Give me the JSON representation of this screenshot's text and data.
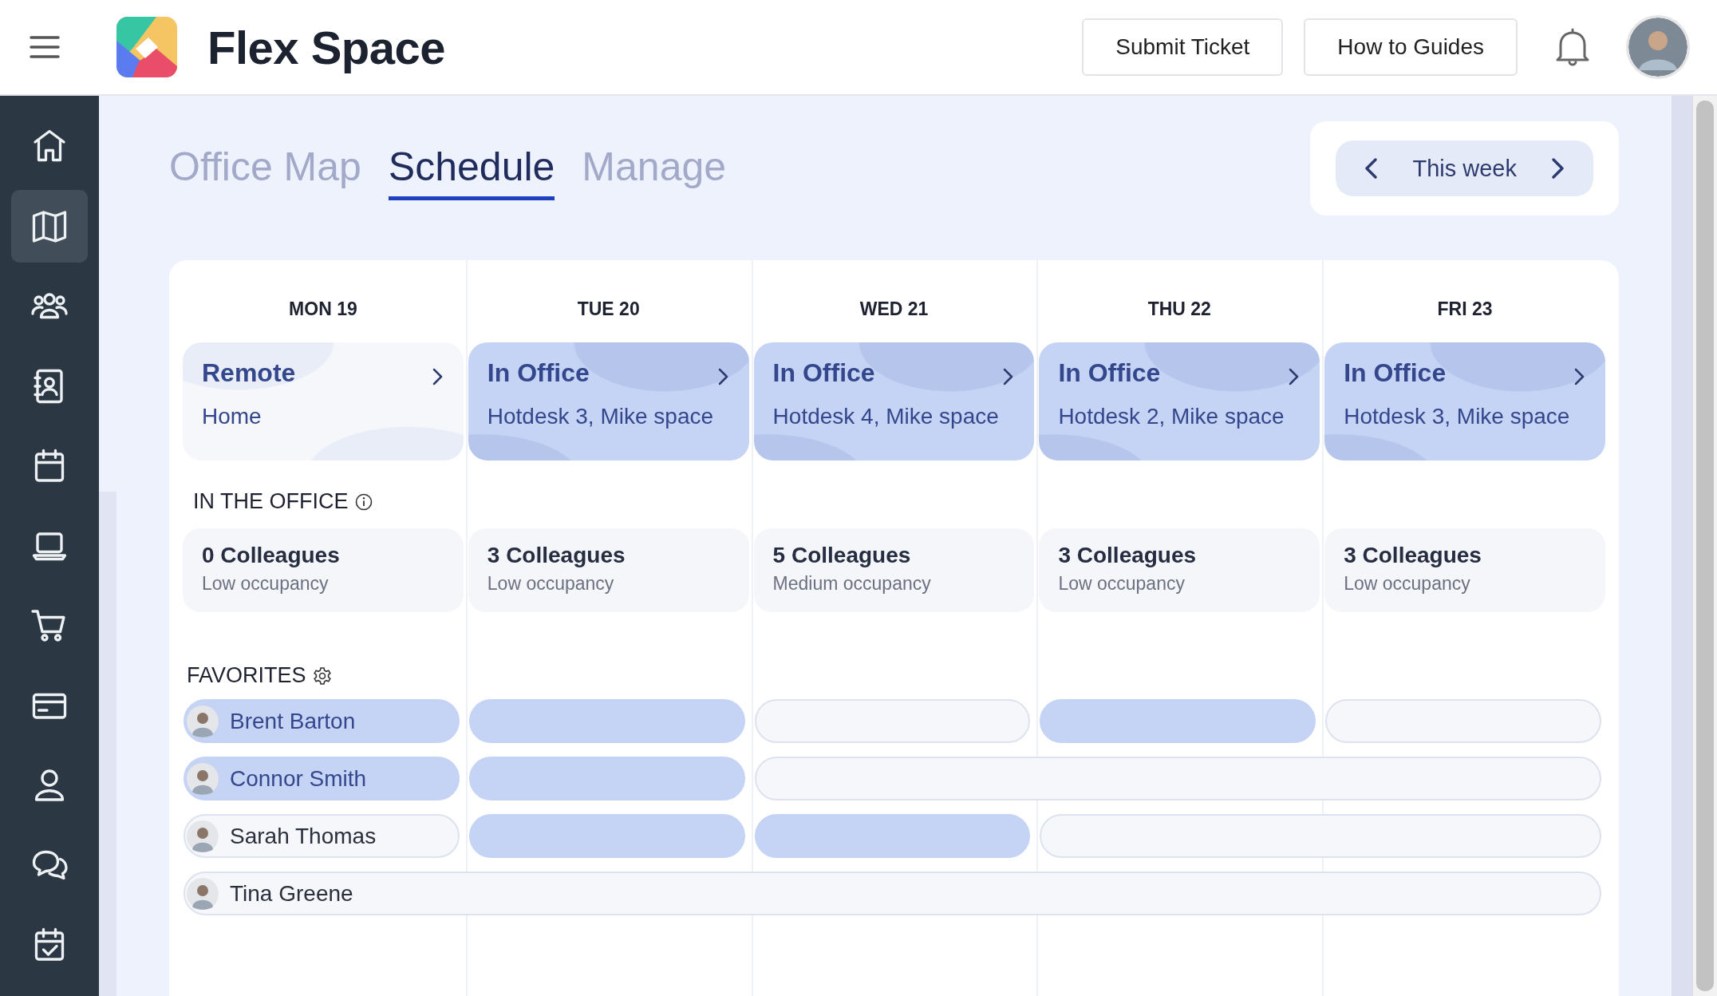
{
  "header": {
    "title": "Flex Space",
    "buttons": [
      "Submit Ticket",
      "How to Guides"
    ]
  },
  "sidebar": {
    "items": [
      {
        "selected": false
      },
      {
        "selected": true
      },
      {
        "selected": false
      },
      {
        "selected": false
      },
      {
        "selected": false
      },
      {
        "selected": false
      },
      {
        "selected": false
      },
      {
        "selected": false
      },
      {
        "selected": false
      },
      {
        "selected": false
      },
      {
        "selected": false
      }
    ]
  },
  "tabs": [
    {
      "label": "Office Map",
      "selected": false
    },
    {
      "label": "Schedule",
      "selected": true
    },
    {
      "label": "Manage",
      "selected": false
    }
  ],
  "week_nav": {
    "label": "This week"
  },
  "days": [
    {
      "label": "MON 19",
      "kind": "remote",
      "status": "Remote",
      "place": "Home",
      "colleagues": "0 Colleagues",
      "occupancy": "Low occupancy"
    },
    {
      "label": "TUE 20",
      "kind": "office",
      "status": "In Office",
      "place": "Hotdesk 3, Mike space",
      "colleagues": "3 Colleagues",
      "occupancy": "Low occupancy"
    },
    {
      "label": "WED 21",
      "kind": "office",
      "status": "In Office",
      "place": "Hotdesk 4, Mike space",
      "colleagues": "5 Colleagues",
      "occupancy": "Medium occupancy"
    },
    {
      "label": "THU 22",
      "kind": "office",
      "status": "In Office",
      "place": "Hotdesk 2, Mike space",
      "colleagues": "3 Colleagues",
      "occupancy": "Low occupancy"
    },
    {
      "label": "FRI 23",
      "kind": "office",
      "status": "In Office",
      "place": "Hotdesk 3, Mike space",
      "colleagues": "3 Colleagues",
      "occupancy": "Low occupancy"
    }
  ],
  "in_office_label": "IN THE OFFICE",
  "favorites_label": "FAVORITES",
  "favorites": [
    {
      "name": "Brent Barton",
      "in_office": [
        true,
        true,
        false,
        true,
        false
      ]
    },
    {
      "name": "Connor Smith",
      "in_office": [
        true,
        true,
        false,
        false,
        false
      ]
    },
    {
      "name": "Sarah Thomas",
      "in_office": [
        false,
        true,
        true,
        false,
        false
      ]
    },
    {
      "name": "Tina Greene",
      "in_office": [
        false,
        false,
        false,
        false,
        false
      ]
    }
  ]
}
